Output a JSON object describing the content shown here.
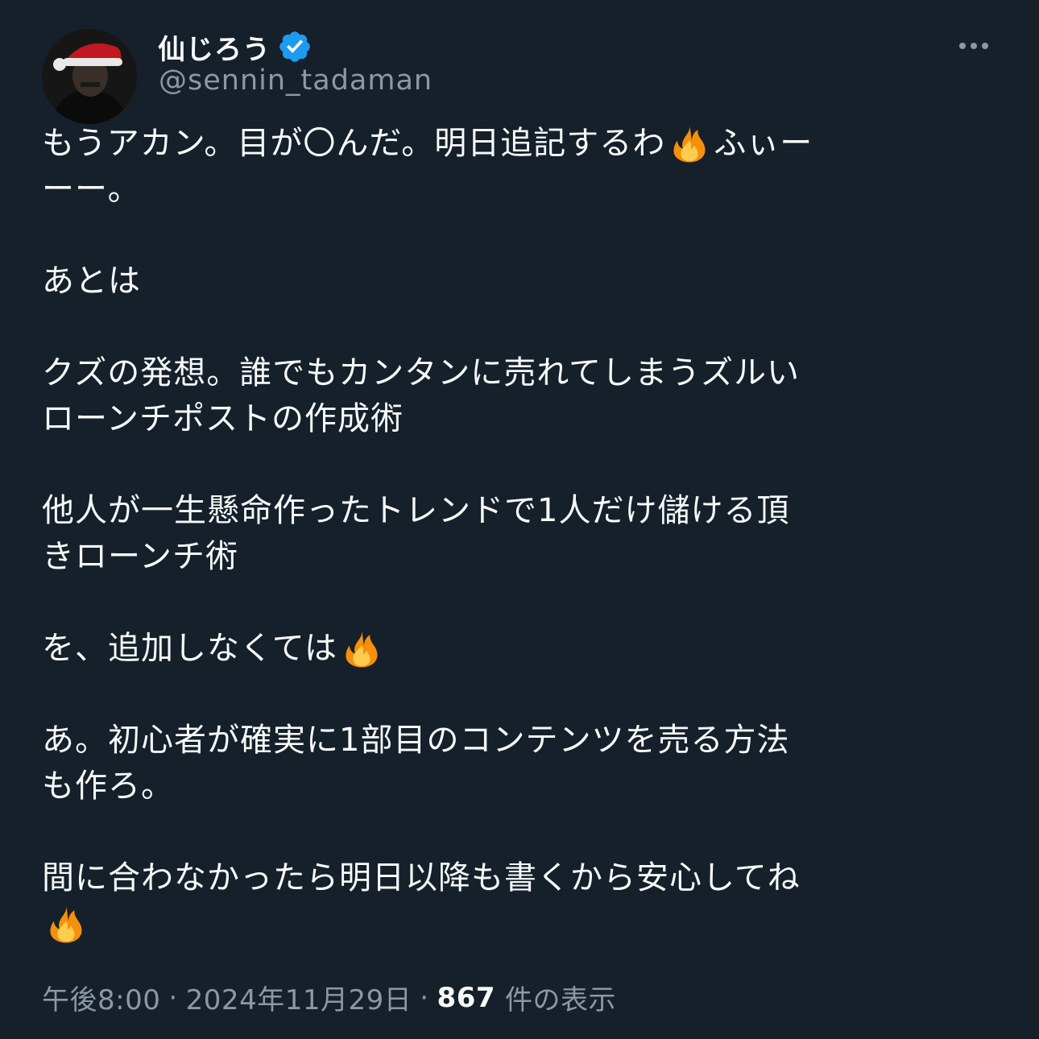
{
  "author": {
    "display_name": "仙じろう",
    "handle": "@sennin_tadaman",
    "verified": true,
    "avatar_icon": "avatar-santa-hat",
    "verified_icon": "verified-badge-icon",
    "verified_color": "#1d9bf0"
  },
  "more_icon": "more-options-icon",
  "post": {
    "lines": [
      {
        "text": "もうアカン。目が〇んだ。明日追記するわ",
        "emoji_after": "fire",
        "tail": "ふぃー"
      },
      {
        "text": "ーー。"
      },
      {
        "blank": true
      },
      {
        "text": "あとは"
      },
      {
        "blank": true
      },
      {
        "text": "クズの発想。誰でもカンタンに売れてしまうズルい"
      },
      {
        "text": "ローンチポストの作成術"
      },
      {
        "blank": true
      },
      {
        "text": "他人が一生懸命作ったトレンドで1人だけ儲ける頂"
      },
      {
        "text": "きローンチ術"
      },
      {
        "blank": true
      },
      {
        "text": "を、追加しなくては",
        "emoji_after": "fire"
      },
      {
        "blank": true
      },
      {
        "text": "あ。初心者が確実に1部目のコンテンツを売る方法"
      },
      {
        "text": "も作ろ。"
      },
      {
        "blank": true
      },
      {
        "text": "間に合わなかったら明日以降も書くから安心してね"
      },
      {
        "emoji_only": "fire"
      }
    ]
  },
  "meta": {
    "time": "午後8:00",
    "separator": "·",
    "date": "2024年11月29日",
    "views_count": "867",
    "views_label": "件の表示"
  },
  "colors": {
    "background": "#15202b",
    "text": "#f7f9f9",
    "secondary": "#8b98a5"
  }
}
